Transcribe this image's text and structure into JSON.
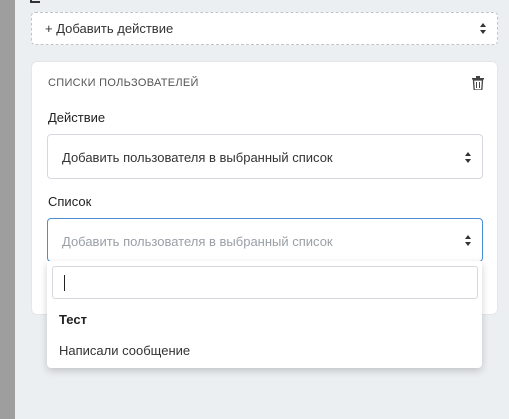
{
  "add_action": {
    "label": "+ Добавить действие",
    "caret_icon": "sort-caret-icon"
  },
  "card": {
    "title": "СПИСКИ ПОЛЬЗОВАТЕЛЕЙ",
    "delete_icon": "trash-icon",
    "action_field": {
      "label": "Действие",
      "value": "Добавить пользователя в выбранный список"
    },
    "list_field": {
      "label": "Список",
      "placeholder": "Добавить пользователя в выбранный список"
    }
  },
  "dropdown": {
    "search_value": "",
    "group_label": "Тест",
    "options": [
      "Написали сообщение"
    ]
  },
  "colors": {
    "focus_border": "#4a8fd6",
    "background": "#eceff1",
    "left_strip": "#9e9e9e"
  }
}
